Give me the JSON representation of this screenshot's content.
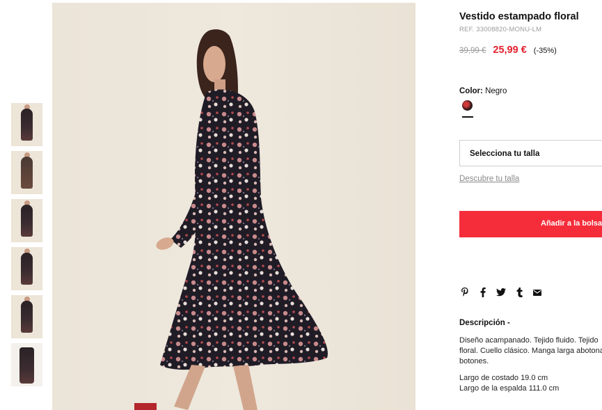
{
  "product": {
    "title": "Vestido estampado floral",
    "ref": "REF. 33008820-MONU-LM",
    "old_price": "39,99 €",
    "new_price": "25,99 €",
    "discount": "(-35%)",
    "color_label": "Color:",
    "color_value": "Negro",
    "size_select_label": "Selecciona tu talla",
    "size_guide_link": "Descubre tu talla",
    "add_to_bag": "Añadir a la bolsa",
    "description_title": "Descripción -",
    "description_lines": [
      "Diseño acampanado. Tejido fluido. Tejido",
      "floral. Cuello clásico. Manga larga abotonada.",
      "botones."
    ],
    "measure_1": "Largo de costado 19.0 cm",
    "measure_2": "Largo de la espalda 111.0 cm"
  },
  "share_icons": [
    "pinterest-icon",
    "facebook-icon",
    "twitter-icon",
    "tumblr-icon",
    "email-icon"
  ],
  "colors": {
    "accent": "#f52d3a",
    "price": "#e5202e",
    "muted": "#9a9a9a"
  }
}
